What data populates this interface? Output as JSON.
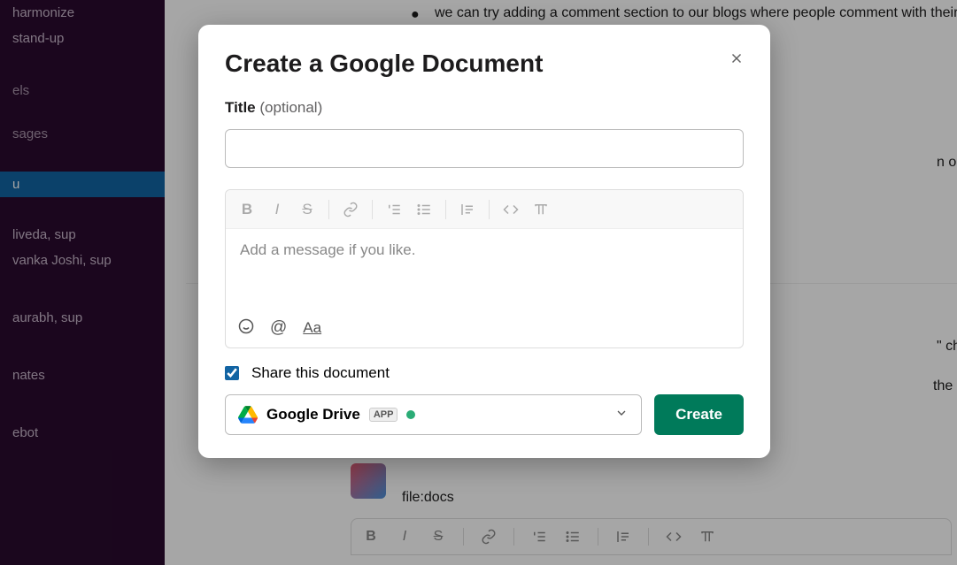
{
  "sidebar": {
    "items": [
      {
        "label": "harmonize"
      },
      {
        "label": "stand-up"
      }
    ],
    "channelsHeader": "els",
    "messagesHeader": "sages",
    "selected": "u",
    "dms": [
      {
        "label": "liveda, sup"
      },
      {
        "label": "vanka Joshi, sup"
      },
      {
        "label": "aurabh, sup"
      },
      {
        "label": "nates"
      },
      {
        "label": "ebot"
      }
    ]
  },
  "background": {
    "line1": "we can try adding a comment section to our blogs where people comment with their feedback a",
    "line2": "n only sharing our website",
    "line3": "\" character are interprete",
    "line4": "the \"/\" with an empty spa",
    "fileText": "file:docs"
  },
  "modal": {
    "title": "Create a Google Document",
    "titleLabel": "Title",
    "optional": "(optional)",
    "messagePlaceholder": "Add a message if you like.",
    "shareLabel": "Share this document",
    "shareChecked": true,
    "destination": "Google Drive",
    "appBadge": "APP",
    "createLabel": "Create"
  }
}
